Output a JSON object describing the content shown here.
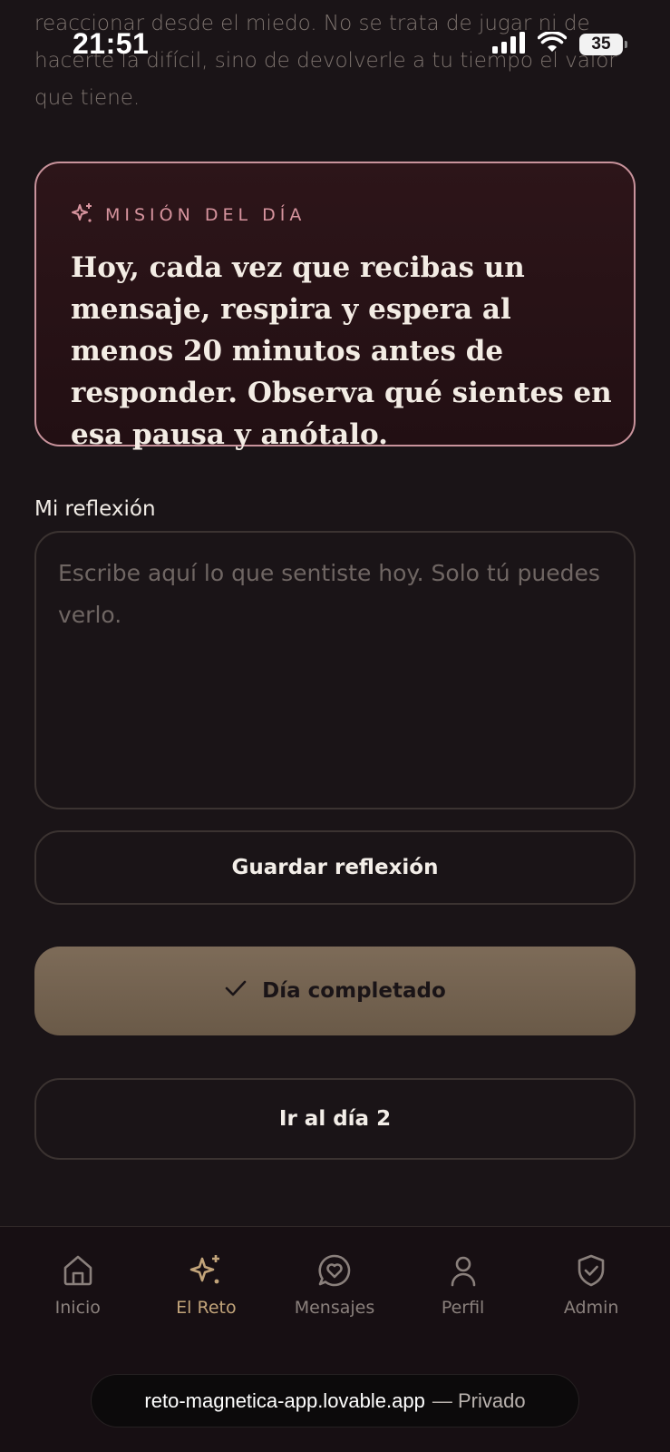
{
  "status_bar": {
    "time": "21:51",
    "battery": "35"
  },
  "intro": {
    "text": "reaccionar desde el miedo. No se trata de jugar ni de hacerte la difícil, sino de devolverle a tu tiempo el valor que tiene."
  },
  "mission": {
    "label": "MISIÓN DEL DÍA",
    "text": "Hoy, cada vez que recibas un mensaje, respira y espera al menos 20 minutos antes de responder. Observa qué sientes en esa pausa y anótalo."
  },
  "reflection": {
    "label": "Mi reflexión",
    "placeholder": "Escribe aquí lo que sentiste hoy. Solo tú puedes verlo.",
    "value": ""
  },
  "buttons": {
    "save": "Guardar reflexión",
    "completed": "Día completado",
    "next_day": "Ir al día 2"
  },
  "nav": {
    "items": [
      {
        "label": "Inicio",
        "icon": "home-icon"
      },
      {
        "label": "El Reto",
        "icon": "sparkles-icon",
        "active": true
      },
      {
        "label": "Mensajes",
        "icon": "message-heart-icon"
      },
      {
        "label": "Perfil",
        "icon": "user-icon"
      },
      {
        "label": "Admin",
        "icon": "shield-check-icon"
      }
    ]
  },
  "browser": {
    "url": "reto-magnetica-app.lovable.app",
    "mode": "— Privado"
  },
  "colors": {
    "background": "#1a1417",
    "accent_gold": "#c2a47a",
    "mission_border": "#c9939c",
    "mission_label": "#d7949e",
    "complete_button": "#7d6b58"
  }
}
